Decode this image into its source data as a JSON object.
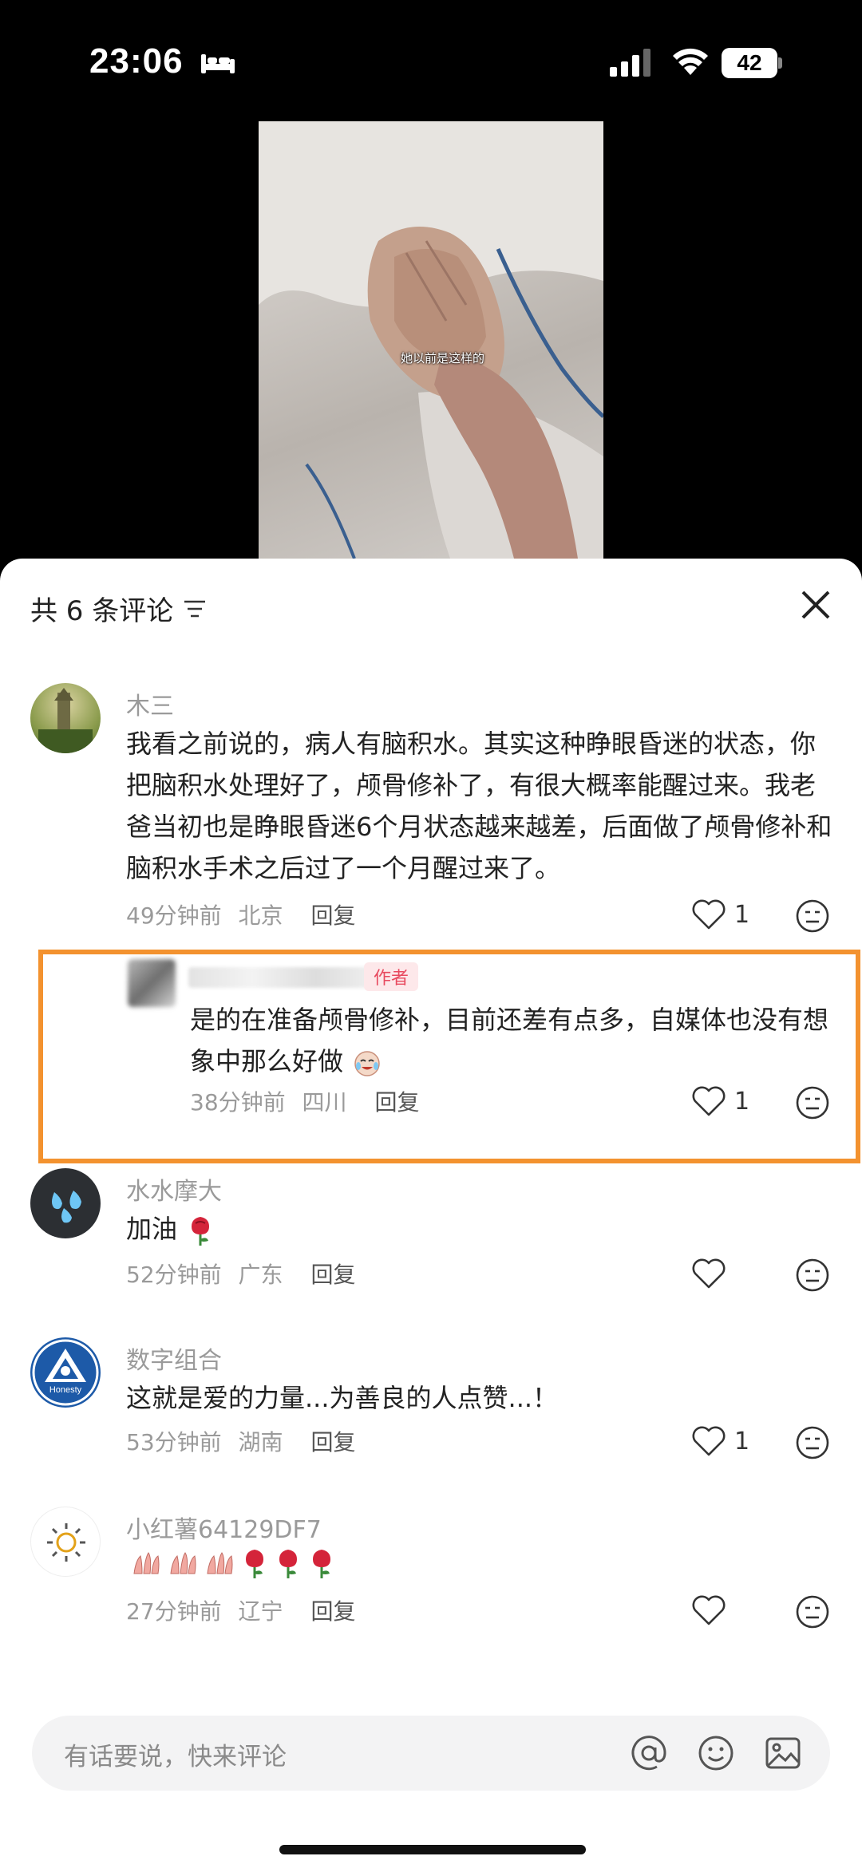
{
  "status_bar": {
    "time": "23:06",
    "battery": "42"
  },
  "video": {
    "caption": "她以前是这样的"
  },
  "sheet": {
    "title": "共 6 条评论"
  },
  "comments": [
    {
      "username": "木三",
      "content": "我看之前说的，病人有脑积水。其实这种睁眼昏迷的状态，你把脑积水处理好了，颅骨修补了，有很大概率能醒过来。我老爸当初也是睁眼昏迷6个月状态越来越差，后面做了颅骨修补和脑积水手术之后过了一个月醒过来了。",
      "time": "49分钟前",
      "location": "北京",
      "reply": "回复",
      "likes": "1"
    },
    {
      "username": "",
      "tag": "作者",
      "content": "是的在准备颅骨修补，目前还差有点多，自媒体也没有想象中那么好做",
      "time": "38分钟前",
      "location": "四川",
      "reply": "回复",
      "likes": "1"
    },
    {
      "username": "水水摩大",
      "content": "加油",
      "time": "52分钟前",
      "location": "广东",
      "reply": "回复",
      "likes": ""
    },
    {
      "username": "数字组合",
      "content": "这就是爱的力量...为善良的人点赞...！",
      "time": "53分钟前",
      "location": "湖南",
      "reply": "回复",
      "likes": "1",
      "avatar_text": "Honesty"
    },
    {
      "username": "小红薯64129DF7",
      "content": "",
      "time": "27分钟前",
      "location": "辽宁",
      "reply": "回复",
      "likes": ""
    }
  ],
  "input": {
    "placeholder": "有话要说，快来评论"
  },
  "colors": {
    "highlight": "#f3922f",
    "author_tag": "#e84a5f"
  }
}
